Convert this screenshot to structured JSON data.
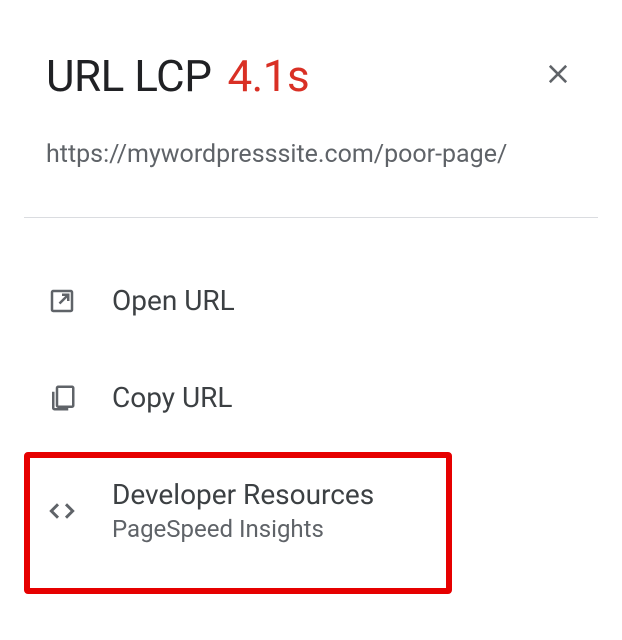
{
  "header": {
    "title": "URL LCP",
    "metric_value": "4.1s"
  },
  "url": "https://mywordpresssite.com/poor-page/",
  "actions": {
    "open": {
      "label": "Open URL"
    },
    "copy": {
      "label": "Copy URL"
    },
    "dev_resources": {
      "label": "Developer Resources",
      "sublabel": "PageSpeed Insights"
    }
  }
}
